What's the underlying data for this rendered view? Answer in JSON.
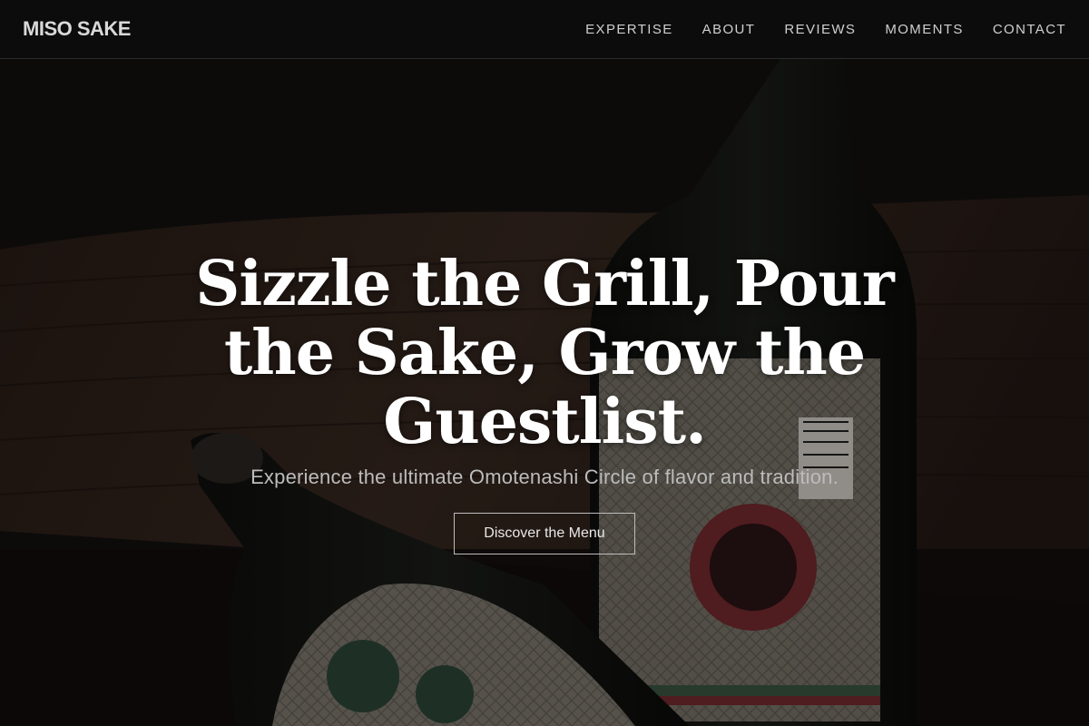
{
  "header": {
    "logo": "MISO SAKE",
    "nav": [
      "EXPERTISE",
      "ABOUT",
      "REVIEWS",
      "MOMENTS",
      "CONTACT"
    ]
  },
  "hero": {
    "headline": "Sizzle the Grill, Pour the Sake, Grow the Guestlist.",
    "subtitle": "Experience the ultimate Omotenashi Circle of flavor and tradition.",
    "cta_label": "Discover the Menu"
  },
  "colors": {
    "background": "#0c0c0c",
    "headline": "#ffffff",
    "subtitle": "#bcbcbc"
  }
}
